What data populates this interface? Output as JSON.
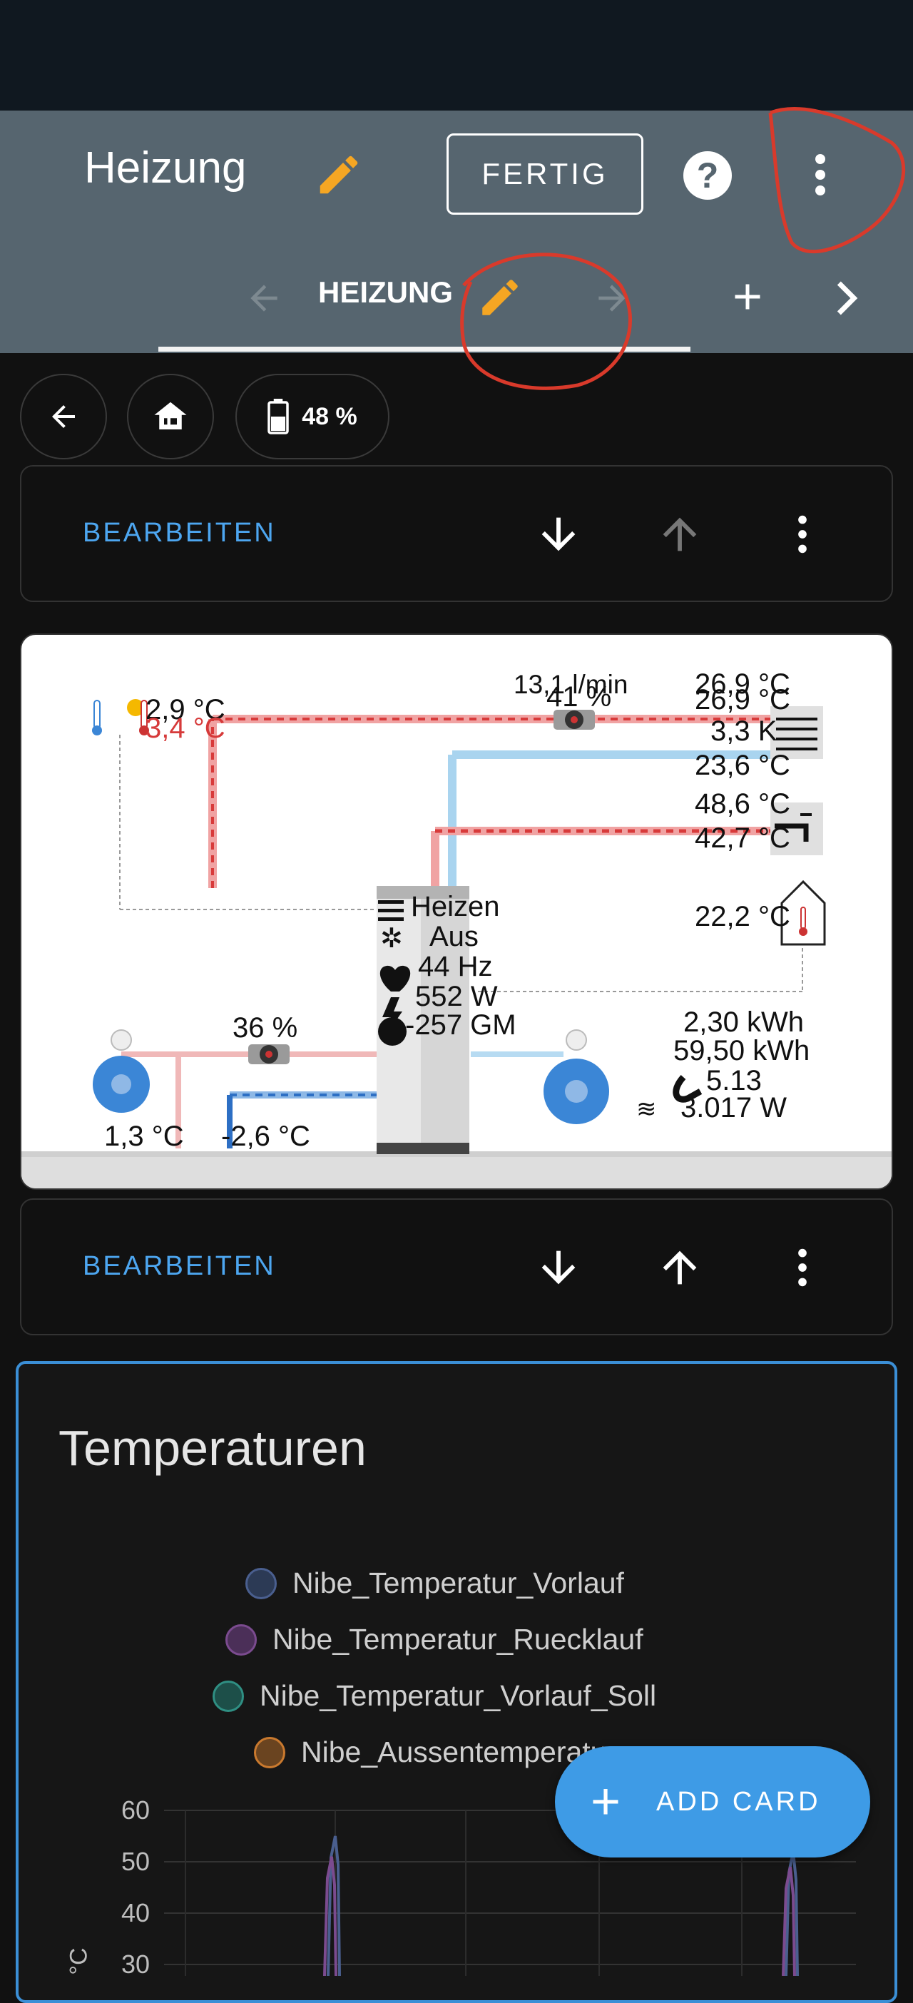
{
  "header": {
    "title": "Heizung",
    "done_label": "FERTIG",
    "help_label": "?"
  },
  "tabs": {
    "active_label": "HEIZUNG"
  },
  "chips": {
    "battery_value": "48 %"
  },
  "edit_bar": {
    "label": "BEARBEITEN"
  },
  "heating_diagram": {
    "outdoor_temp_1": "2,9 °C",
    "outdoor_temp_2": "3,4 °C",
    "flow_rate": "13,1 l/min",
    "pump_pct_top": "41 %",
    "supply_temp_1": "26,9 °C",
    "supply_temp_2": "26,9 °C",
    "delta_k": "3,3 K",
    "return_temp": "23,6 °C",
    "hot_water_temp_1": "48,6 °C",
    "hot_water_temp_2": "42,7 °C",
    "indoor_temp": "22,2 °C",
    "mode": "Heizen",
    "cooling": "Aus",
    "compressor_freq": "44 Hz",
    "power": "552 W",
    "degree_minutes": "-257 GM",
    "energy_1": "2,30 kWh",
    "energy_2": "59,50 kWh",
    "cop": "5.13",
    "heat_output": "3.017 W",
    "pump_pct_bottom": "36 %",
    "brine_in": "1,3 °C",
    "brine_out": "-2,6 °C"
  },
  "chart_card": {
    "title": "Temperaturen",
    "add_card_label": "ADD CARD"
  },
  "chart_data": {
    "type": "line",
    "title": "Temperaturen",
    "ylabel": "°C",
    "y_ticks": [
      "60",
      "50",
      "40",
      "30"
    ],
    "ylim": [
      30,
      60
    ],
    "series": [
      {
        "name": "Nibe_Temperatur_Vorlauf",
        "color": "#4a5f8f"
      },
      {
        "name": "Nibe_Temperatur_Ruecklauf",
        "color": "#7b4b8f"
      },
      {
        "name": "Nibe_Temperatur_Vorlauf_Soll",
        "color": "#2f8f83"
      },
      {
        "name": "Nibe_Aussentemperatur",
        "color": "#c9792e"
      }
    ],
    "legend_placement": "top",
    "grid": true
  },
  "colors": {
    "accent": "#4da6f0",
    "header_bg": "#56656f",
    "pencil": "#f5a623",
    "annotation": "#d93a2b"
  }
}
